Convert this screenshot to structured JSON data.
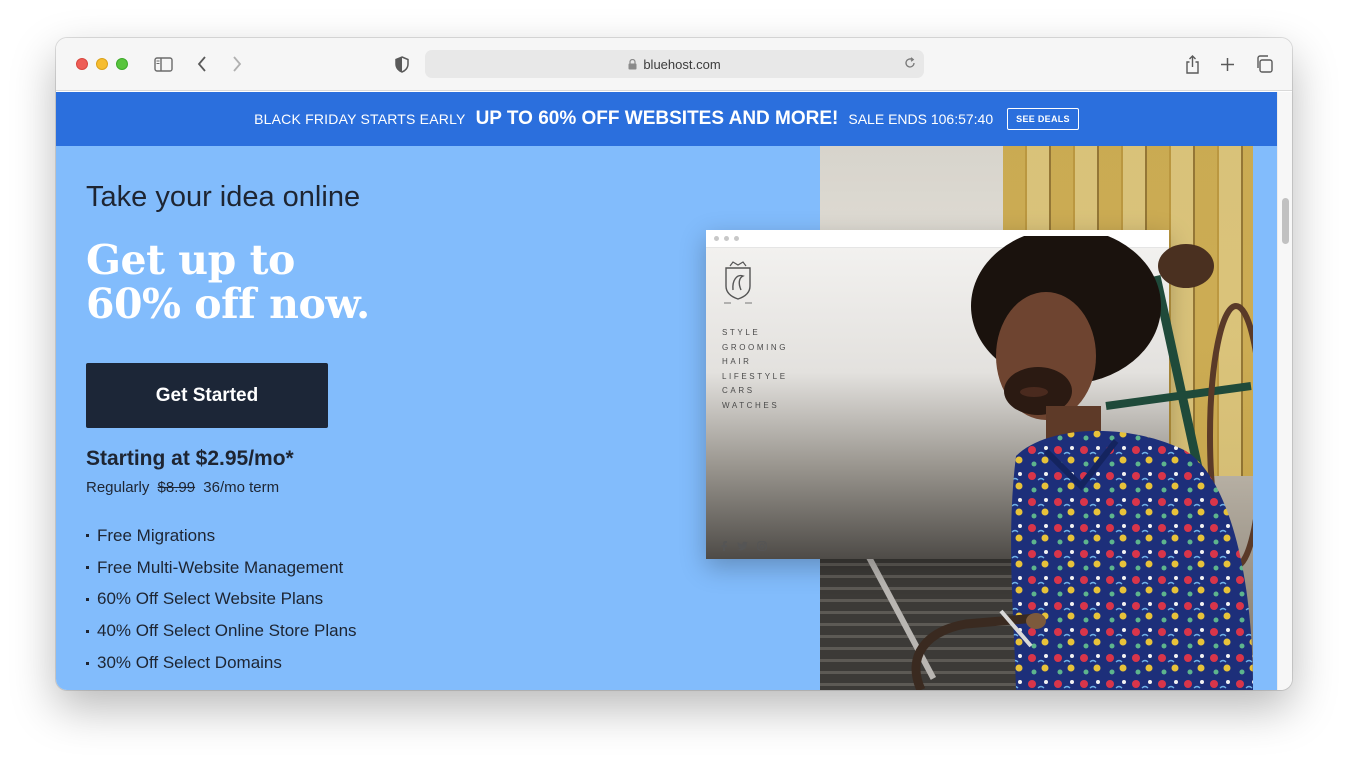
{
  "browser": {
    "url": "bluehost.com"
  },
  "banner": {
    "pre_text": "BLACK FRIDAY STARTS EARLY",
    "main_text": "UP TO 60% OFF WEBSITES AND MORE!",
    "timer_text": "SALE ENDS 106:57:40",
    "deals_label": "SEE DEALS",
    "color": "#2b6fdd"
  },
  "hero": {
    "eyebrow": "Take your idea online",
    "headline_line1": "Get up to",
    "headline_line2": "60% off now.",
    "cta_label": "Get Started",
    "price": "Starting at $2.95/mo*",
    "regular_prefix": "Regularly",
    "regular_price": "$8.99",
    "regular_term": "36/mo term",
    "features": [
      "Free Migrations",
      "Free Multi-Website Management",
      "60% Off Select Website Plans",
      "40% Off Select Online Store Plans",
      "30% Off Select Domains"
    ],
    "background_color": "#82bcfc"
  },
  "mockup": {
    "nav": [
      "STYLE",
      "GROOMING",
      "HAIR",
      "LIFESTYLE",
      "CARS",
      "WATCHES"
    ],
    "social_icons": [
      "facebook-icon",
      "twitter-icon",
      "instagram-icon"
    ]
  }
}
